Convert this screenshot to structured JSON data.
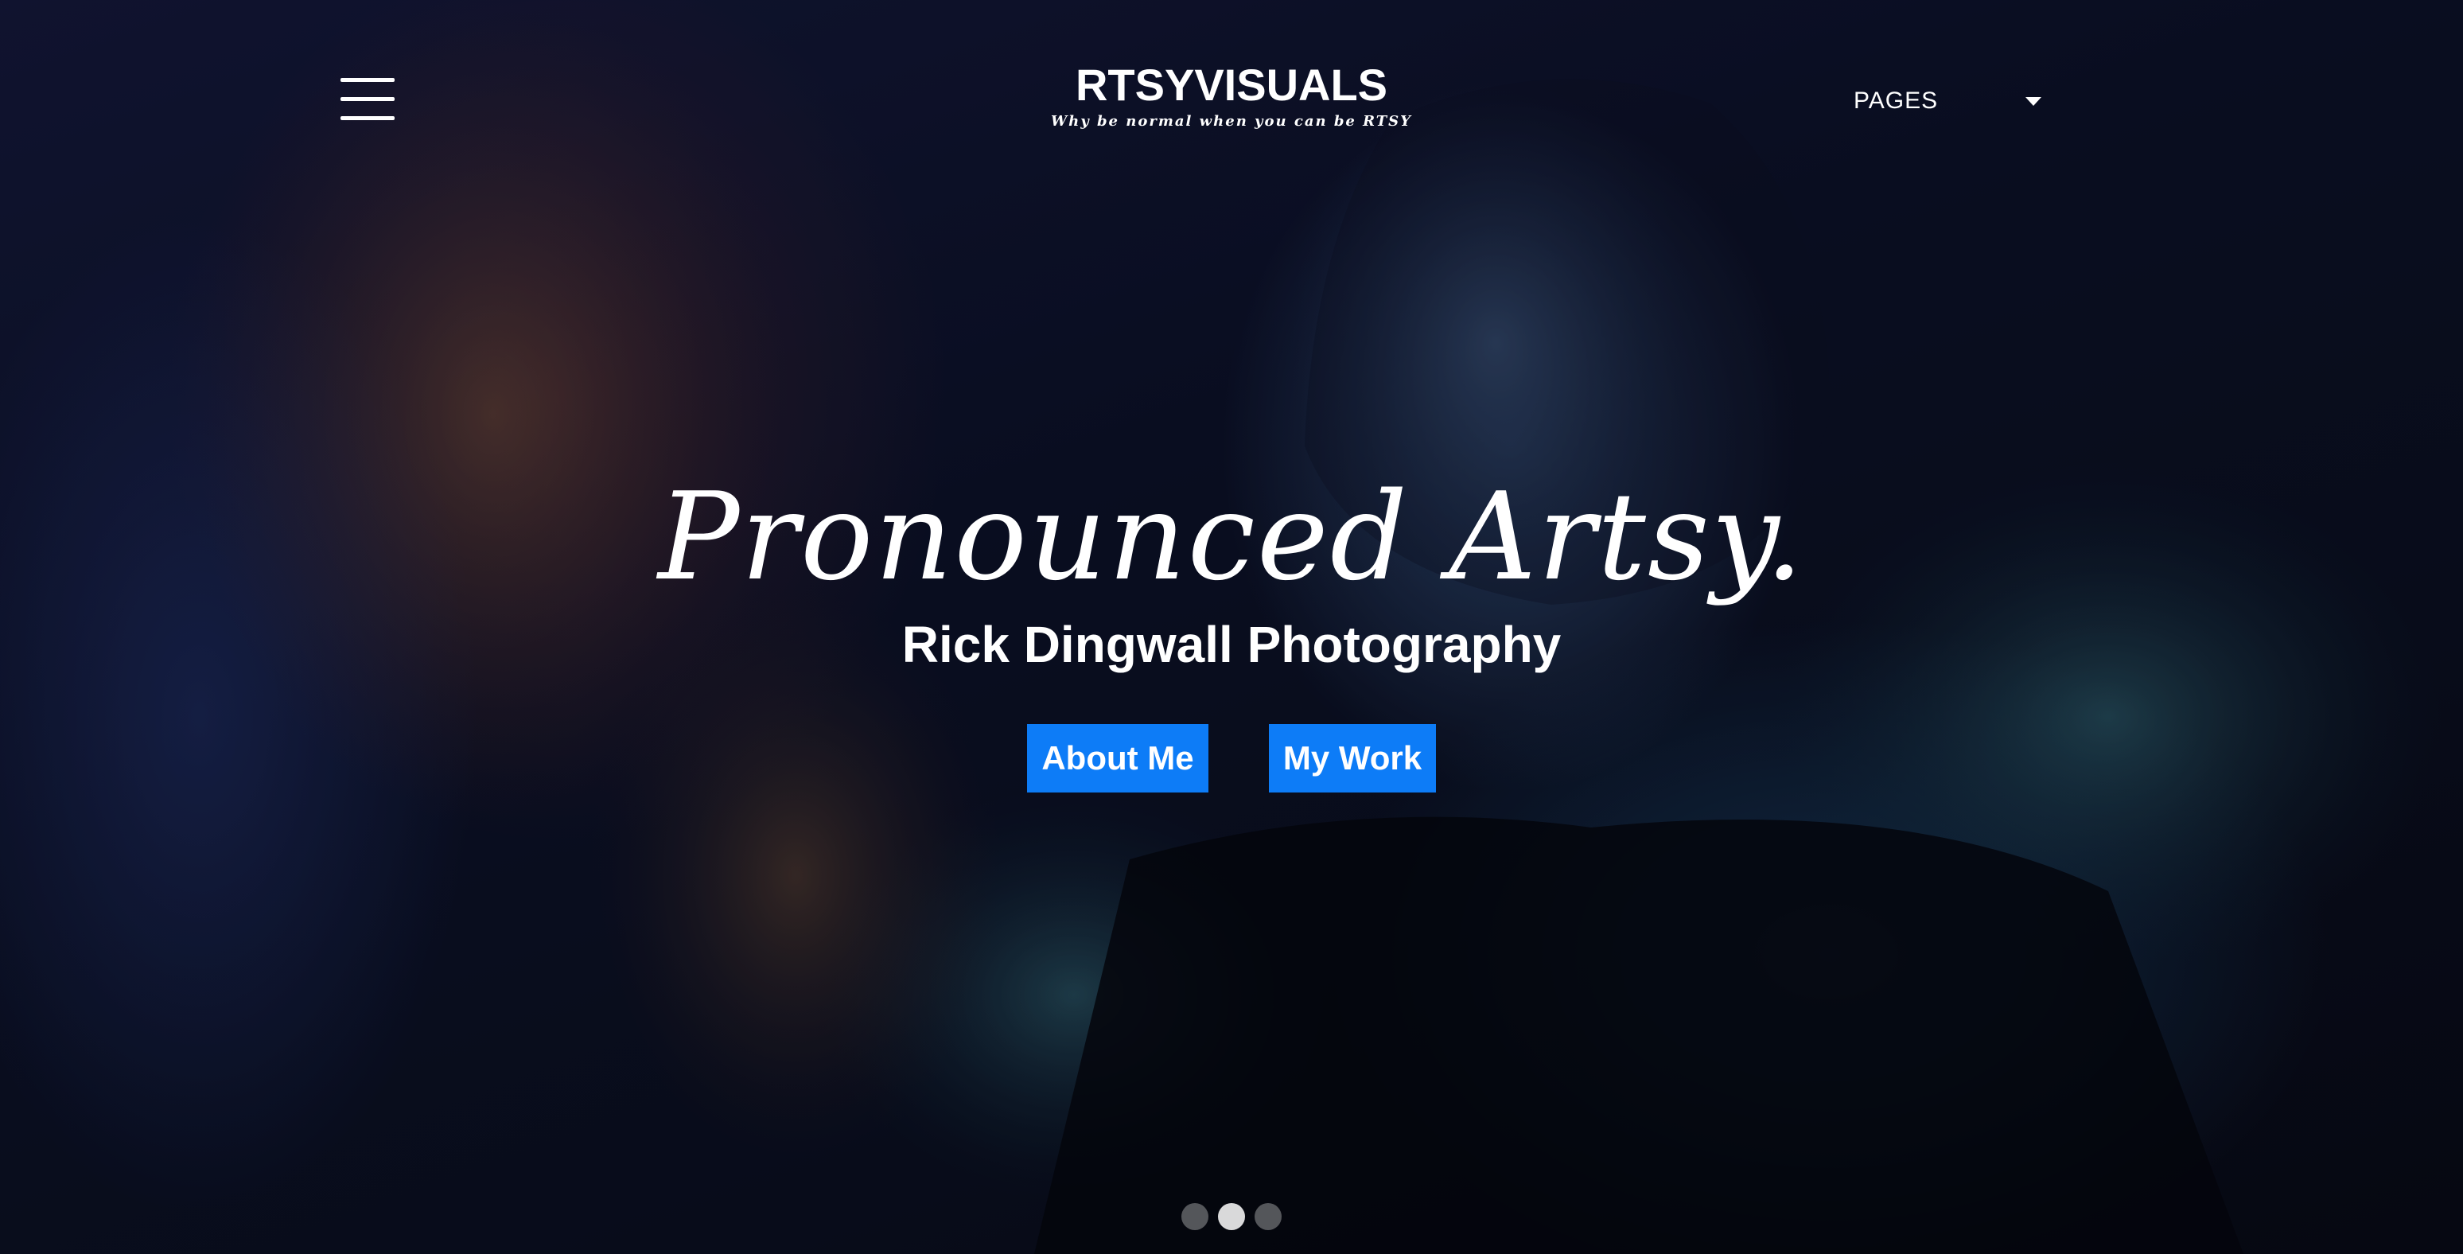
{
  "header": {
    "brand": "RTSYVISUALS",
    "tagline": "Why be normal when you can be RTSY",
    "menu_icon": "hamburger-menu-icon",
    "pages_label": "PAGES",
    "pages_caret_icon": "caret-down-icon"
  },
  "hero": {
    "title": "Pronounced Artsy.",
    "subtitle": "Rick Dingwall Photography",
    "buttons": {
      "about": "About Me",
      "work": "My Work"
    }
  },
  "carousel": {
    "slide_count": 3,
    "active_index": 1
  },
  "colors": {
    "button_bg": "#0d7cf7",
    "text": "#ffffff"
  }
}
